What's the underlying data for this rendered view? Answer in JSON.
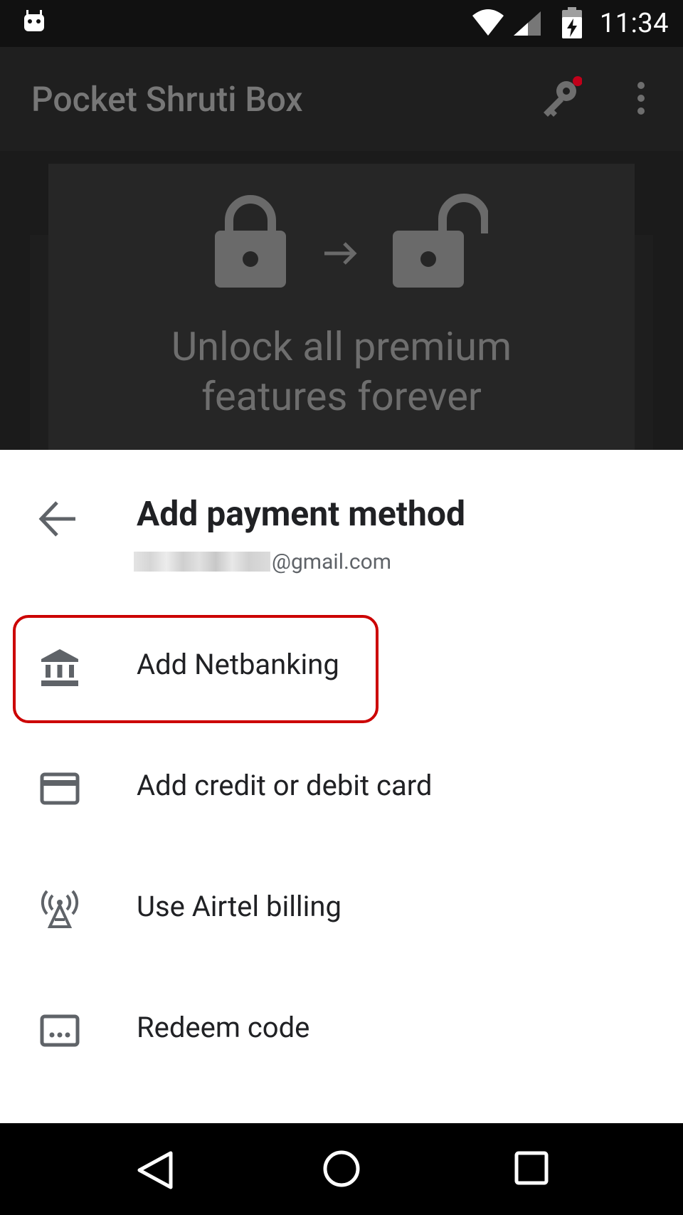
{
  "status_bar": {
    "time": "11:34",
    "icons": [
      "android-icon",
      "wifi-icon",
      "signal-icon",
      "battery-charging-icon"
    ]
  },
  "app_bar": {
    "title": "Pocket Shruti Box",
    "icons": [
      "key-icon",
      "more-vert-icon"
    ],
    "key_badge_color": "#c2001a"
  },
  "background": {
    "unlock_line1": "Unlock all premium",
    "unlock_line2": "features forever",
    "icons": [
      "lock-closed-icon",
      "arrow-right-icon",
      "lock-open-icon"
    ]
  },
  "sheet": {
    "title": "Add payment method",
    "account_domain": "@gmail.com",
    "options": [
      {
        "label": "Add Netbanking",
        "icon": "bank-icon",
        "highlighted": true
      },
      {
        "label": "Add credit or debit card",
        "icon": "credit-card-icon"
      },
      {
        "label": "Use Airtel billing",
        "icon": "antenna-icon"
      },
      {
        "label": "Redeem code",
        "icon": "redeem-code-icon"
      }
    ]
  },
  "colors": {
    "highlight": "#cc0000",
    "sheet_background": "#ffffff",
    "text_primary": "#202124",
    "icon_gray": "#5f6368"
  },
  "nav_bar": {
    "buttons": [
      "nav-back-icon",
      "nav-home-icon",
      "nav-recents-icon"
    ]
  }
}
